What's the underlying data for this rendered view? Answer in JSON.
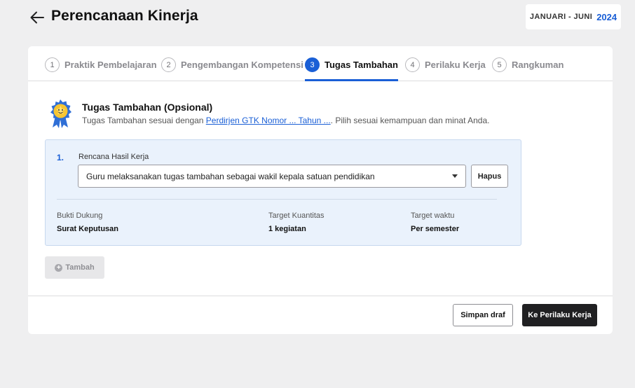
{
  "header": {
    "back_icon": "arrow-left-icon",
    "title": "Perencanaan Kinerja",
    "period_label": "JANUARI - JUNI",
    "period_year": "2024"
  },
  "tabs": [
    {
      "num": "1",
      "label": "Praktik Pembelajaran",
      "active": false
    },
    {
      "num": "2",
      "label": "Pengembangan Kompetensi",
      "active": false
    },
    {
      "num": "3",
      "label": "Tugas Tambahan",
      "active": true
    },
    {
      "num": "4",
      "label": "Perilaku Kerja",
      "active": false
    },
    {
      "num": "5",
      "label": "Rangkuman",
      "active": false
    }
  ],
  "section": {
    "icon": "award-badge-icon",
    "title": "Tugas Tambahan (Opsional)",
    "desc_before": "Tugas Tambahan sesuai dengan ",
    "desc_link": "Perdirjen GTK Nomor ... Tahun ...",
    "desc_after": ". Pilih sesuai kemampuan dan minat Anda."
  },
  "entry": {
    "number": "1.",
    "rhk_label": "Rencana Hasil Kerja",
    "rhk_value": "Guru melaksanakan tugas tambahan sebagai wakil kepala satuan pendidikan",
    "delete_label": "Hapus",
    "meta": [
      {
        "key": "Bukti Dukung",
        "value": "Surat Keputusan"
      },
      {
        "key": "Target Kuantitas",
        "value": "1 kegiatan"
      },
      {
        "key": "Target waktu",
        "value": "Per semester"
      }
    ]
  },
  "add_label": "Tambah",
  "footer": {
    "save_draft_label": "Simpan draf",
    "next_label": "Ke Perilaku Kerja"
  },
  "colors": {
    "accent": "#1a5fd6",
    "entry_bg": "#eaf2fc",
    "primary_button": "#202022"
  }
}
